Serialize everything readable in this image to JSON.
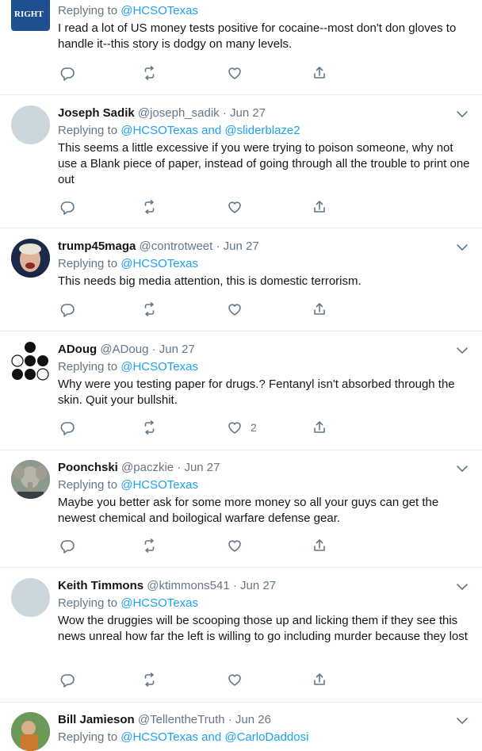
{
  "reply_prefix": "Replying to",
  "connector": "and",
  "tweets": [
    {
      "avatar_text": "RIGHT",
      "reply_handles": [
        "@HCSOTexas"
      ],
      "text": "I read a lot of US money tests positive for cocaine--most don't don gloves to handle it--this story is dodgy on many levels."
    },
    {
      "name": "Joseph Sadik",
      "meta": "@joseph_sadik · Jun 27",
      "reply_handles": [
        "@HCSOTexas",
        "@sliderblaze2"
      ],
      "text": "This seems a little excessive if you were trying to poison someone, why not use a Blank piece of paper, instead of going through all the trouble to print one out"
    },
    {
      "name": "trump45maga",
      "meta": "@controtweet · Jun 27",
      "reply_handles": [
        "@HCSOTexas"
      ],
      "text": "This needs big media attention, this is domestic terrorism."
    },
    {
      "name": "ADoug",
      "meta": "@ADoug · Jun 27",
      "reply_handles": [
        "@HCSOTexas"
      ],
      "text": "Why were you testing paper for drugs.? Fentanyl isn't absorbed through the skin.  Quit your bullshit.",
      "like_count": "2"
    },
    {
      "name": "Poonchski",
      "meta": "@paczkie · Jun 27",
      "reply_handles": [
        "@HCSOTexas"
      ],
      "text": "Maybe you better ask for some more money so all your guys can get the newest chemical and boilogical warfare defense gear."
    },
    {
      "name": "Keith Timmons",
      "meta": "@ktimmons541 · Jun 27",
      "reply_handles": [
        "@HCSOTexas"
      ],
      "text": "Wow the druggies will be scooping those up and licking them if they see this news unreal how far the left is willing to go including murder because they lost"
    },
    {
      "name": "Bill Jamieson",
      "meta": "@TellentheTruth · Jun 26",
      "reply_handles": [
        "@HCSOTexas",
        "@CarloDaddosi"
      ]
    }
  ],
  "colors": {
    "link": "#1da1f2",
    "muted": "#657786",
    "text": "#14171a",
    "divider": "#e6ecf0"
  },
  "icons": [
    "reply-icon",
    "retweet-icon",
    "like-icon",
    "share-icon",
    "chevron-down-icon"
  ]
}
